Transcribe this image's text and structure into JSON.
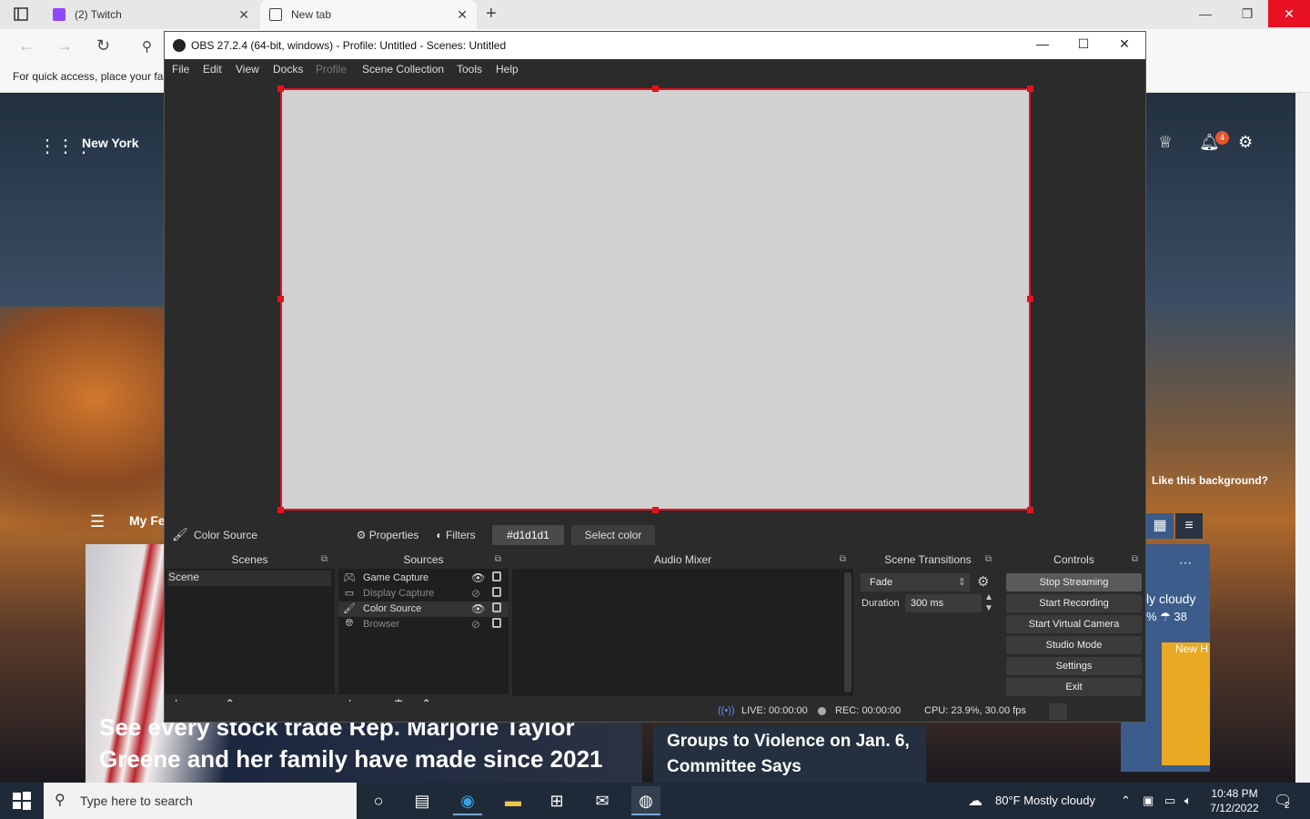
{
  "browser": {
    "tabs": [
      {
        "label": "(2) Twitch",
        "icon": "twitch-icon"
      },
      {
        "label": "New tab",
        "icon": "newtab-page-icon"
      }
    ],
    "favorites_hint": "For quick access, place your fa",
    "colors": {
      "tab_bg": "#e7e7e7",
      "active_tab_bg": "#f7f7f7",
      "close_red": "#e81123"
    }
  },
  "newtab": {
    "location": "New York",
    "notification_count": "4",
    "like_background": "Like this background?",
    "my_feed": "My Fe",
    "news1_headline": "See every stock trade Rep. Marjorie Taylor Greene and her family have made since 2021",
    "news2_headline": "Groups to Violence on Jan. 6, Committee Says",
    "weather_card_line1": "ly cloudy",
    "weather_card_line2": "%  ☂ 38",
    "weather_map_label": "New H"
  },
  "obs": {
    "title": "OBS 27.2.4 (64-bit, windows) - Profile: Untitled - Scenes: Untitled",
    "menu": [
      "File",
      "Edit",
      "View",
      "Docks",
      "Profile",
      "Scene Collection",
      "Tools",
      "Help"
    ],
    "menu_disabled": "Profile",
    "preview": {
      "canvas_color": "#d1d1d1",
      "selection_color": "#e0141e"
    },
    "source_toolbar": {
      "selected_source": "Color Source",
      "properties": "Properties",
      "filters": "Filters",
      "color_value": "#d1d1d1",
      "select_color": "Select color"
    },
    "docks": {
      "scenes": {
        "title": "Scenes",
        "items": [
          "Scene"
        ]
      },
      "sources": {
        "title": "Sources",
        "items": [
          {
            "name": "Game Capture",
            "icon": "gamepad-icon",
            "visible": true
          },
          {
            "name": "Display Capture",
            "icon": "monitor-icon",
            "visible": false
          },
          {
            "name": "Color Source",
            "icon": "brush-icon",
            "visible": true,
            "selected": true
          },
          {
            "name": "Browser",
            "icon": "globe-icon",
            "visible": false
          }
        ]
      },
      "audio_mixer": {
        "title": "Audio Mixer"
      },
      "scene_transitions": {
        "title": "Scene Transitions",
        "transition": "Fade",
        "duration_label": "Duration",
        "duration_value": "300 ms"
      },
      "controls": {
        "title": "Controls",
        "buttons": [
          "Stop Streaming",
          "Start Recording",
          "Start Virtual Camera",
          "Studio Mode",
          "Settings",
          "Exit"
        ]
      }
    },
    "status": {
      "live": "LIVE: 00:00:00",
      "rec": "REC: 00:00:00",
      "cpu": "CPU: 23.9%, 30.00 fps"
    }
  },
  "taskbar": {
    "search_placeholder": "Type here to search",
    "weather": "80°F  Mostly cloudy",
    "time": "10:48 PM",
    "date": "7/12/2022",
    "notifications": "2"
  }
}
